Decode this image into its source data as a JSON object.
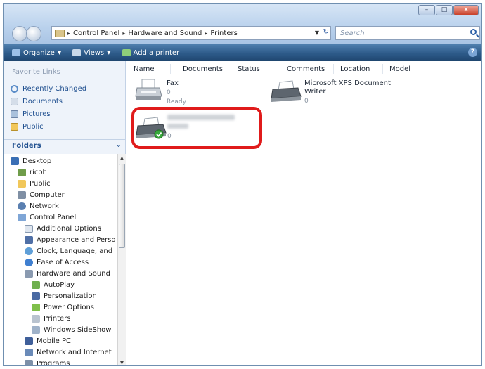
{
  "window": {
    "buttons": {
      "minimize": "–",
      "maximize": "□",
      "close": "×"
    }
  },
  "address": {
    "crumbs": [
      "Control Panel",
      "Hardware and Sound",
      "Printers"
    ],
    "search_placeholder": "Search"
  },
  "toolbar": {
    "organize": "Organize",
    "views": "Views",
    "add_printer": "Add a printer",
    "help": "?"
  },
  "sidebar": {
    "favorite_links_title": "Favorite Links",
    "favorites": [
      "Recently Changed",
      "Documents",
      "Pictures",
      "Public"
    ],
    "folders_label": "Folders",
    "tree": [
      "Desktop",
      "ricoh",
      "Public",
      "Computer",
      "Network",
      "Control Panel",
      "Additional Options",
      "Appearance and Perso",
      "Clock, Language, and",
      "Ease of Access",
      "Hardware and Sound",
      "AutoPlay",
      "Personalization",
      "Power Options",
      "Printers",
      "Windows SideShow",
      "Mobile PC",
      "Network and Internet",
      "Programs"
    ]
  },
  "main": {
    "columns": [
      "Name",
      "Documents",
      "Status",
      "Comments",
      "Location",
      "Model"
    ],
    "items": [
      {
        "name": "Fax",
        "documents": "0",
        "status": "Ready"
      },
      {
        "name": "Microsoft XPS Document Writer",
        "name_line1": "Microsoft XPS Document",
        "name_line2": "Writer",
        "documents": "0"
      },
      {
        "documents": "0"
      }
    ]
  },
  "colors": {
    "toolbar": "#2d5a89",
    "highlight": "#e01b1b",
    "link": "#1f4f8f"
  }
}
